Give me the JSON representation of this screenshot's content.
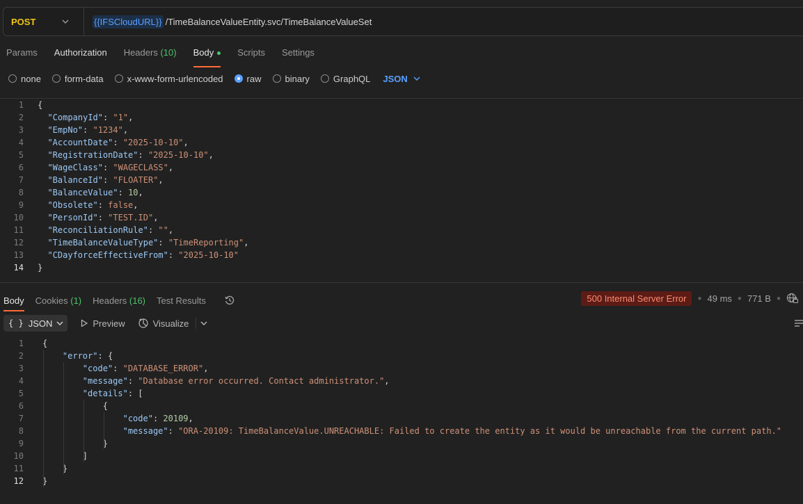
{
  "request": {
    "method": "POST",
    "url_variable": "{{IFSCloudURL}}",
    "url_path": "/TimeBalanceValueEntity.svc/TimeBalanceValueSet"
  },
  "request_tabs": [
    {
      "label": "Params"
    },
    {
      "label": "Authorization"
    },
    {
      "label": "Headers",
      "count": "(10)"
    },
    {
      "label": "Body"
    },
    {
      "label": "Scripts"
    },
    {
      "label": "Settings"
    }
  ],
  "body_types": [
    "none",
    "form-data",
    "x-www-form-urlencoded",
    "raw",
    "binary",
    "GraphQL"
  ],
  "body_type_selected": "raw",
  "body_language": "JSON",
  "request_body_lines": [
    {
      "n": "1",
      "text": "{"
    },
    {
      "n": "2",
      "key": "\"CompanyId\"",
      "val": "\"1\"",
      "vt": "str",
      "comma": ","
    },
    {
      "n": "3",
      "key": "\"EmpNo\"",
      "val": "\"1234\"",
      "vt": "str",
      "comma": ","
    },
    {
      "n": "4",
      "key": "\"AccountDate\"",
      "val": "\"2025-10-10\"",
      "vt": "str",
      "comma": ","
    },
    {
      "n": "5",
      "key": "\"RegistrationDate\"",
      "val": "\"2025-10-10\"",
      "vt": "str",
      "comma": ","
    },
    {
      "n": "6",
      "key": "\"WageClass\"",
      "val": "\"WAGECLASS\"",
      "vt": "str",
      "comma": ","
    },
    {
      "n": "7",
      "key": "\"BalanceId\"",
      "val": "\"FLOATER\"",
      "vt": "str",
      "comma": ","
    },
    {
      "n": "8",
      "key": "\"BalanceValue\"",
      "val": "10",
      "vt": "num",
      "comma": ","
    },
    {
      "n": "9",
      "key": "\"Obsolete\"",
      "val": "false",
      "vt": "kw",
      "comma": ","
    },
    {
      "n": "10",
      "key": "\"PersonId\"",
      "val": "\"TEST.ID\"",
      "vt": "str",
      "comma": ","
    },
    {
      "n": "11",
      "key": "\"ReconciliationRule\"",
      "val": "\"\"",
      "vt": "str",
      "comma": ","
    },
    {
      "n": "12",
      "key": "\"TimeBalanceValueType\"",
      "val": "\"TimeReporting\"",
      "vt": "str",
      "comma": ","
    },
    {
      "n": "13",
      "key": "\"CDayforceEffectiveFrom\"",
      "val": "\"2025-10-10\"",
      "vt": "str",
      "comma": ""
    },
    {
      "n": "14",
      "text": "}"
    }
  ],
  "response_tabs": [
    {
      "label": "Body"
    },
    {
      "label": "Cookies",
      "count": "(1)"
    },
    {
      "label": "Headers",
      "count": "(16)"
    },
    {
      "label": "Test Results"
    }
  ],
  "response_status": {
    "status": "500 Internal Server Error",
    "time": "49 ms",
    "size": "771 B"
  },
  "response_toolbar": {
    "format": "JSON",
    "preview": "Preview",
    "visualize": "Visualize"
  },
  "response_body_lines": [
    {
      "n": "1",
      "indent": 0,
      "text": "{"
    },
    {
      "n": "2",
      "indent": 1,
      "key": "\"error\"",
      "text": "{"
    },
    {
      "n": "3",
      "indent": 2,
      "key": "\"code\"",
      "val": "\"DATABASE_ERROR\"",
      "vt": "str",
      "comma": ","
    },
    {
      "n": "4",
      "indent": 2,
      "key": "\"message\"",
      "val": "\"Database error occurred. Contact administrator.\"",
      "vt": "str",
      "comma": ","
    },
    {
      "n": "5",
      "indent": 2,
      "key": "\"details\"",
      "text": "["
    },
    {
      "n": "6",
      "indent": 3,
      "text": "{"
    },
    {
      "n": "7",
      "indent": 4,
      "key": "\"code\"",
      "val": "20109",
      "vt": "num",
      "comma": ","
    },
    {
      "n": "8",
      "indent": 4,
      "key": "\"message\"",
      "val": "\"ORA-20109: TimeBalanceValue.UNREACHABLE: Failed to create the entity as it would be unreachable from the current path.\"",
      "vt": "str",
      "comma": ""
    },
    {
      "n": "9",
      "indent": 3,
      "text": "}"
    },
    {
      "n": "10",
      "indent": 2,
      "text": "]"
    },
    {
      "n": "11",
      "indent": 1,
      "text": "}"
    },
    {
      "n": "12",
      "indent": 0,
      "text": "}"
    }
  ],
  "colors": {
    "accent": "#ff6c37",
    "method": "#f0c419",
    "link": "#5aa0ff",
    "count": "#4fc36b",
    "error_bg": "#5c1c15",
    "error_text": "#ff8a72"
  },
  "icons": [
    "chevron-down-icon",
    "history-icon",
    "network-icon",
    "play-icon",
    "visualize-icon",
    "wrap-lines-icon"
  ]
}
